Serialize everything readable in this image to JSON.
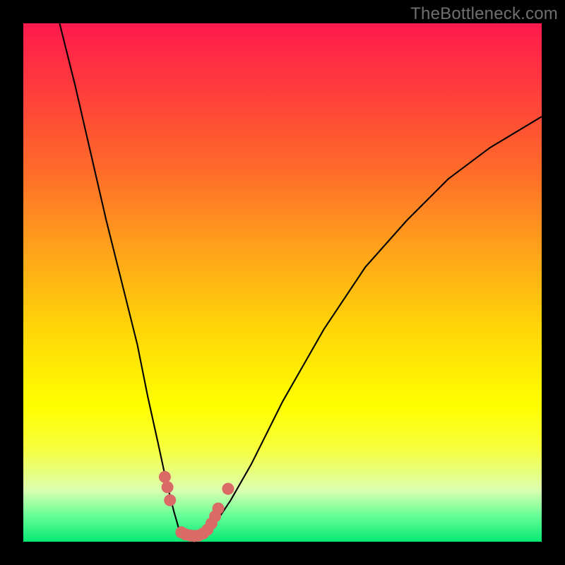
{
  "watermark": "TheBottleneck.com",
  "colors": {
    "frame": "#000000",
    "gradient_top": "#ff1a4d",
    "gradient_bottom": "#07e874",
    "curve": "#000000",
    "marker": "#da6a66"
  },
  "chart_data": {
    "type": "line",
    "title": "",
    "xlabel": "",
    "ylabel": "",
    "xlim": [
      0,
      100
    ],
    "ylim": [
      0,
      100
    ],
    "series": [
      {
        "name": "curve",
        "x": [
          7,
          10,
          13,
          16,
          19,
          22,
          24,
          26,
          27.5,
          29,
          30,
          31,
          32,
          33.5,
          35,
          37,
          40,
          44,
          50,
          58,
          66,
          74,
          82,
          90,
          100
        ],
        "y": [
          100,
          88,
          75,
          62,
          50,
          38,
          28,
          19,
          12,
          6,
          2.5,
          1,
          1,
          1,
          1.5,
          3.5,
          8,
          15,
          27,
          41,
          53,
          62,
          70,
          76,
          82
        ]
      }
    ],
    "markers": [
      {
        "x": 27.3,
        "y": 12.5
      },
      {
        "x": 27.8,
        "y": 10.5
      },
      {
        "x": 28.3,
        "y": 8.0
      },
      {
        "x": 30.5,
        "y": 1.8
      },
      {
        "x": 31.3,
        "y": 1.4
      },
      {
        "x": 32.2,
        "y": 1.2
      },
      {
        "x": 33.0,
        "y": 1.1
      },
      {
        "x": 33.8,
        "y": 1.2
      },
      {
        "x": 34.7,
        "y": 1.6
      },
      {
        "x": 35.5,
        "y": 2.3
      },
      {
        "x": 36.3,
        "y": 3.5
      },
      {
        "x": 37.0,
        "y": 4.9
      },
      {
        "x": 37.6,
        "y": 6.4
      },
      {
        "x": 39.5,
        "y": 10.2
      }
    ]
  }
}
